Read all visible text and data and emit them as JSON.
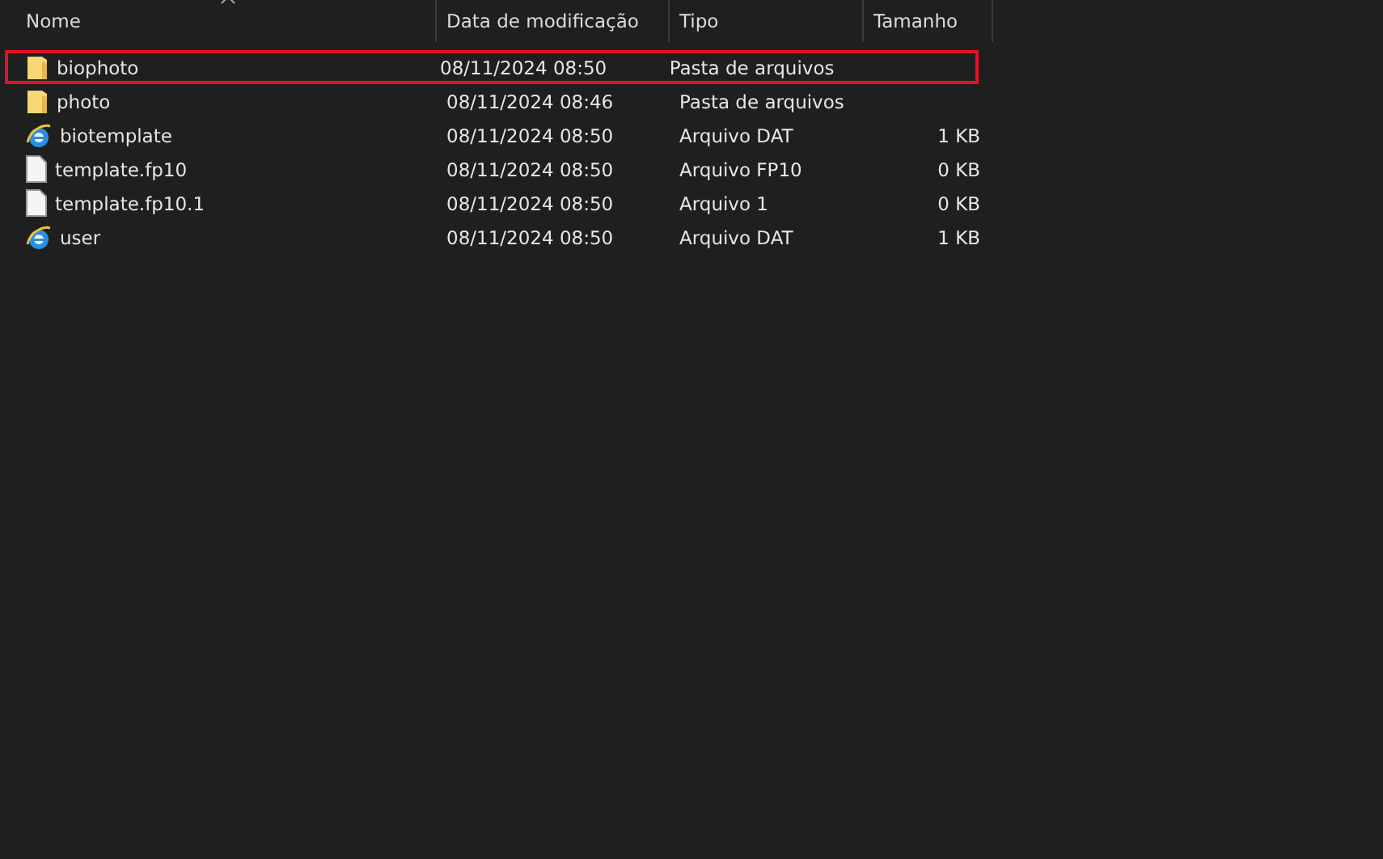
{
  "columns": [
    {
      "label": "Nome",
      "sorted": true
    },
    {
      "label": "Data de modificação"
    },
    {
      "label": "Tipo"
    },
    {
      "label": "Tamanho"
    }
  ],
  "rows": [
    {
      "kind": "folder",
      "name": "biophoto",
      "date": "08/11/2024 08:50",
      "type": "Pasta de arquivos",
      "highlighted": true
    },
    {
      "kind": "folder",
      "name": "photo",
      "date": "08/11/2024 08:46",
      "type": "Pasta de arquivos",
      "highlighted": false
    },
    {
      "kind": "web",
      "name": "biotemplate",
      "date": "08/11/2024 08:50",
      "type": "Arquivo DAT",
      "size": "1 KB",
      "highlighted": false
    },
    {
      "kind": "file",
      "name": "template.fp10",
      "date": "08/11/2024 08:50",
      "type": "Arquivo FP10",
      "size": "0 KB",
      "highlighted": false
    },
    {
      "kind": "file",
      "name": "template.fp10.1",
      "date": "08/11/2024 08:50",
      "type": "Arquivo 1",
      "size": "0 KB",
      "highlighted": false
    },
    {
      "kind": "web",
      "name": "user",
      "date": "08/11/2024 08:50",
      "type": "Arquivo DAT",
      "size": "1 KB",
      "highlighted": false
    }
  ]
}
